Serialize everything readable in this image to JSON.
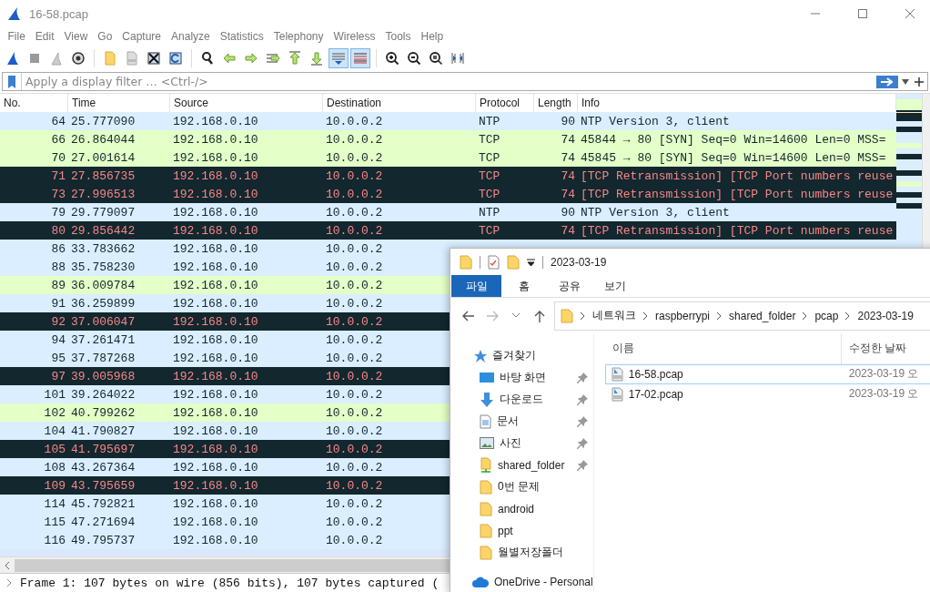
{
  "window": {
    "title": "16-58.pcap"
  },
  "menu": [
    "File",
    "Edit",
    "View",
    "Go",
    "Capture",
    "Analyze",
    "Statistics",
    "Telephony",
    "Wireless",
    "Tools",
    "Help"
  ],
  "toolbar": [
    [
      {
        "kind": "shark",
        "pressed": false
      },
      {
        "kind": "stop",
        "pressed": false
      },
      {
        "kind": "restart",
        "pressed": false
      },
      {
        "kind": "options",
        "pressed": false
      }
    ],
    [
      {
        "kind": "open",
        "pressed": false
      },
      {
        "kind": "save",
        "pressed": false
      },
      {
        "kind": "close",
        "pressed": false
      },
      {
        "kind": "reload",
        "pressed": false
      }
    ],
    [
      {
        "kind": "find",
        "pressed": false
      },
      {
        "kind": "back",
        "pressed": false
      },
      {
        "kind": "forward",
        "pressed": false
      },
      {
        "kind": "goto",
        "pressed": false
      },
      {
        "kind": "first",
        "pressed": false
      },
      {
        "kind": "last",
        "pressed": false
      },
      {
        "kind": "autoscroll",
        "pressed": true
      },
      {
        "kind": "colorize",
        "pressed": true
      }
    ],
    [
      {
        "kind": "zoom_in",
        "pressed": false
      },
      {
        "kind": "zoom_out",
        "pressed": false
      },
      {
        "kind": "zoom_reset",
        "pressed": false
      },
      {
        "kind": "resize",
        "pressed": false
      }
    ]
  ],
  "filter": {
    "placeholder": "Apply a display filter … <Ctrl-/>"
  },
  "packet_list": {
    "columns": [
      "No.",
      "Time",
      "Source",
      "Destination",
      "Protocol",
      "Length",
      "Info"
    ],
    "rows": [
      {
        "no": "64",
        "time": "25.777090",
        "source": "192.168.0.10",
        "destination": "10.0.0.2",
        "protocol": "NTP",
        "length": "90",
        "info": "NTP Version 3, client",
        "kind": "udp"
      },
      {
        "no": "66",
        "time": "26.864044",
        "source": "192.168.0.10",
        "destination": "10.0.0.2",
        "protocol": "TCP",
        "length": "74",
        "info": "45844 → 80 [SYN] Seq=0 Win=14600 Len=0 MSS=",
        "kind": "syn"
      },
      {
        "no": "70",
        "time": "27.001614",
        "source": "192.168.0.10",
        "destination": "10.0.0.2",
        "protocol": "TCP",
        "length": "74",
        "info": "45845 → 80 [SYN] Seq=0 Win=14600 Len=0 MSS=",
        "kind": "syn"
      },
      {
        "no": "71",
        "time": "27.856735",
        "source": "192.168.0.10",
        "destination": "10.0.0.2",
        "protocol": "TCP",
        "length": "74",
        "info": "[TCP Retransmission] [TCP Port numbers reuse",
        "kind": "bad"
      },
      {
        "no": "73",
        "time": "27.996513",
        "source": "192.168.0.10",
        "destination": "10.0.0.2",
        "protocol": "TCP",
        "length": "74",
        "info": "[TCP Retransmission] [TCP Port numbers reuse",
        "kind": "bad"
      },
      {
        "no": "79",
        "time": "29.779097",
        "source": "192.168.0.10",
        "destination": "10.0.0.2",
        "protocol": "NTP",
        "length": "90",
        "info": "NTP Version 3, client",
        "kind": "udp"
      },
      {
        "no": "80",
        "time": "29.856442",
        "source": "192.168.0.10",
        "destination": "10.0.0.2",
        "protocol": "TCP",
        "length": "74",
        "info": "[TCP Retransmission] [TCP Port numbers reuse",
        "kind": "bad"
      },
      {
        "no": "86",
        "time": "33.783662",
        "source": "192.168.0.10",
        "destination": "10.0.0.2",
        "kind": "udp"
      },
      {
        "no": "88",
        "time": "35.758230",
        "source": "192.168.0.10",
        "destination": "10.0.0.2",
        "kind": "udp"
      },
      {
        "no": "89",
        "time": "36.009784",
        "source": "192.168.0.10",
        "destination": "10.0.0.2",
        "kind": "syn"
      },
      {
        "no": "91",
        "time": "36.259899",
        "source": "192.168.0.10",
        "destination": "10.0.0.2",
        "kind": "udp"
      },
      {
        "no": "92",
        "time": "37.006047",
        "source": "192.168.0.10",
        "destination": "10.0.0.2",
        "kind": "bad"
      },
      {
        "no": "94",
        "time": "37.261471",
        "source": "192.168.0.10",
        "destination": "10.0.0.2",
        "kind": "udp"
      },
      {
        "no": "95",
        "time": "37.787268",
        "source": "192.168.0.10",
        "destination": "10.0.0.2",
        "kind": "udp"
      },
      {
        "no": "97",
        "time": "39.005968",
        "source": "192.168.0.10",
        "destination": "10.0.0.2",
        "kind": "bad"
      },
      {
        "no": "101",
        "time": "39.264022",
        "source": "192.168.0.10",
        "destination": "10.0.0.2",
        "kind": "udp"
      },
      {
        "no": "102",
        "time": "40.799262",
        "source": "192.168.0.10",
        "destination": "10.0.0.2",
        "kind": "syn"
      },
      {
        "no": "104",
        "time": "41.790827",
        "source": "192.168.0.10",
        "destination": "10.0.0.2",
        "kind": "udp"
      },
      {
        "no": "105",
        "time": "41.795697",
        "source": "192.168.0.10",
        "destination": "10.0.0.2",
        "kind": "bad"
      },
      {
        "no": "108",
        "time": "43.267364",
        "source": "192.168.0.10",
        "destination": "10.0.0.2",
        "kind": "udp"
      },
      {
        "no": "109",
        "time": "43.795659",
        "source": "192.168.0.10",
        "destination": "10.0.0.2",
        "kind": "bad"
      },
      {
        "no": "114",
        "time": "45.792821",
        "source": "192.168.0.10",
        "destination": "10.0.0.2",
        "kind": "udp"
      },
      {
        "no": "115",
        "time": "47.271694",
        "source": "192.168.0.10",
        "destination": "10.0.0.2",
        "kind": "udp"
      },
      {
        "no": "116",
        "time": "49.795737",
        "source": "192.168.0.10",
        "destination": "10.0.0.2",
        "kind": "udp"
      }
    ]
  },
  "packet_details": [
    {
      "text": "Frame 1: 107 bytes on wire (856 bits), 107 bytes captured (",
      "expanded": false
    }
  ],
  "explorer": {
    "title": "2023-03-19",
    "ribbon_tabs": [
      {
        "label": "파일",
        "kind": "file"
      },
      {
        "label": "홈",
        "kind": "tab"
      },
      {
        "label": "공유",
        "kind": "tab"
      },
      {
        "label": "보기",
        "kind": "tab"
      }
    ],
    "path": [
      "네트워크",
      "raspberrypi",
      "shared_folder",
      "pcap",
      "2023-03-19"
    ],
    "nav": {
      "header": "즐겨찾기",
      "items": [
        {
          "label": "바탕 화면",
          "kind": "desktop",
          "pinned": true
        },
        {
          "label": "다운로드",
          "kind": "download",
          "pinned": true
        },
        {
          "label": "문서",
          "kind": "document",
          "pinned": true
        },
        {
          "label": "사진",
          "kind": "pictures",
          "pinned": true
        },
        {
          "label": "shared_folder",
          "kind": "network",
          "pinned": true
        },
        {
          "label": "0번 문제",
          "kind": "folder",
          "pinned": false
        },
        {
          "label": "android",
          "kind": "folder",
          "pinned": false
        },
        {
          "label": "ppt",
          "kind": "folder",
          "pinned": false
        },
        {
          "label": "월별저장폴더",
          "kind": "folder",
          "pinned": false
        }
      ],
      "footer": "OneDrive - Personal"
    },
    "columns": [
      "이름",
      "수정한 날짜"
    ],
    "files": [
      {
        "name": "16-58.pcap",
        "modified": "2023-03-19 오",
        "selected": true
      },
      {
        "name": "17-02.pcap",
        "modified": "2023-03-19 오",
        "selected": false
      }
    ]
  }
}
